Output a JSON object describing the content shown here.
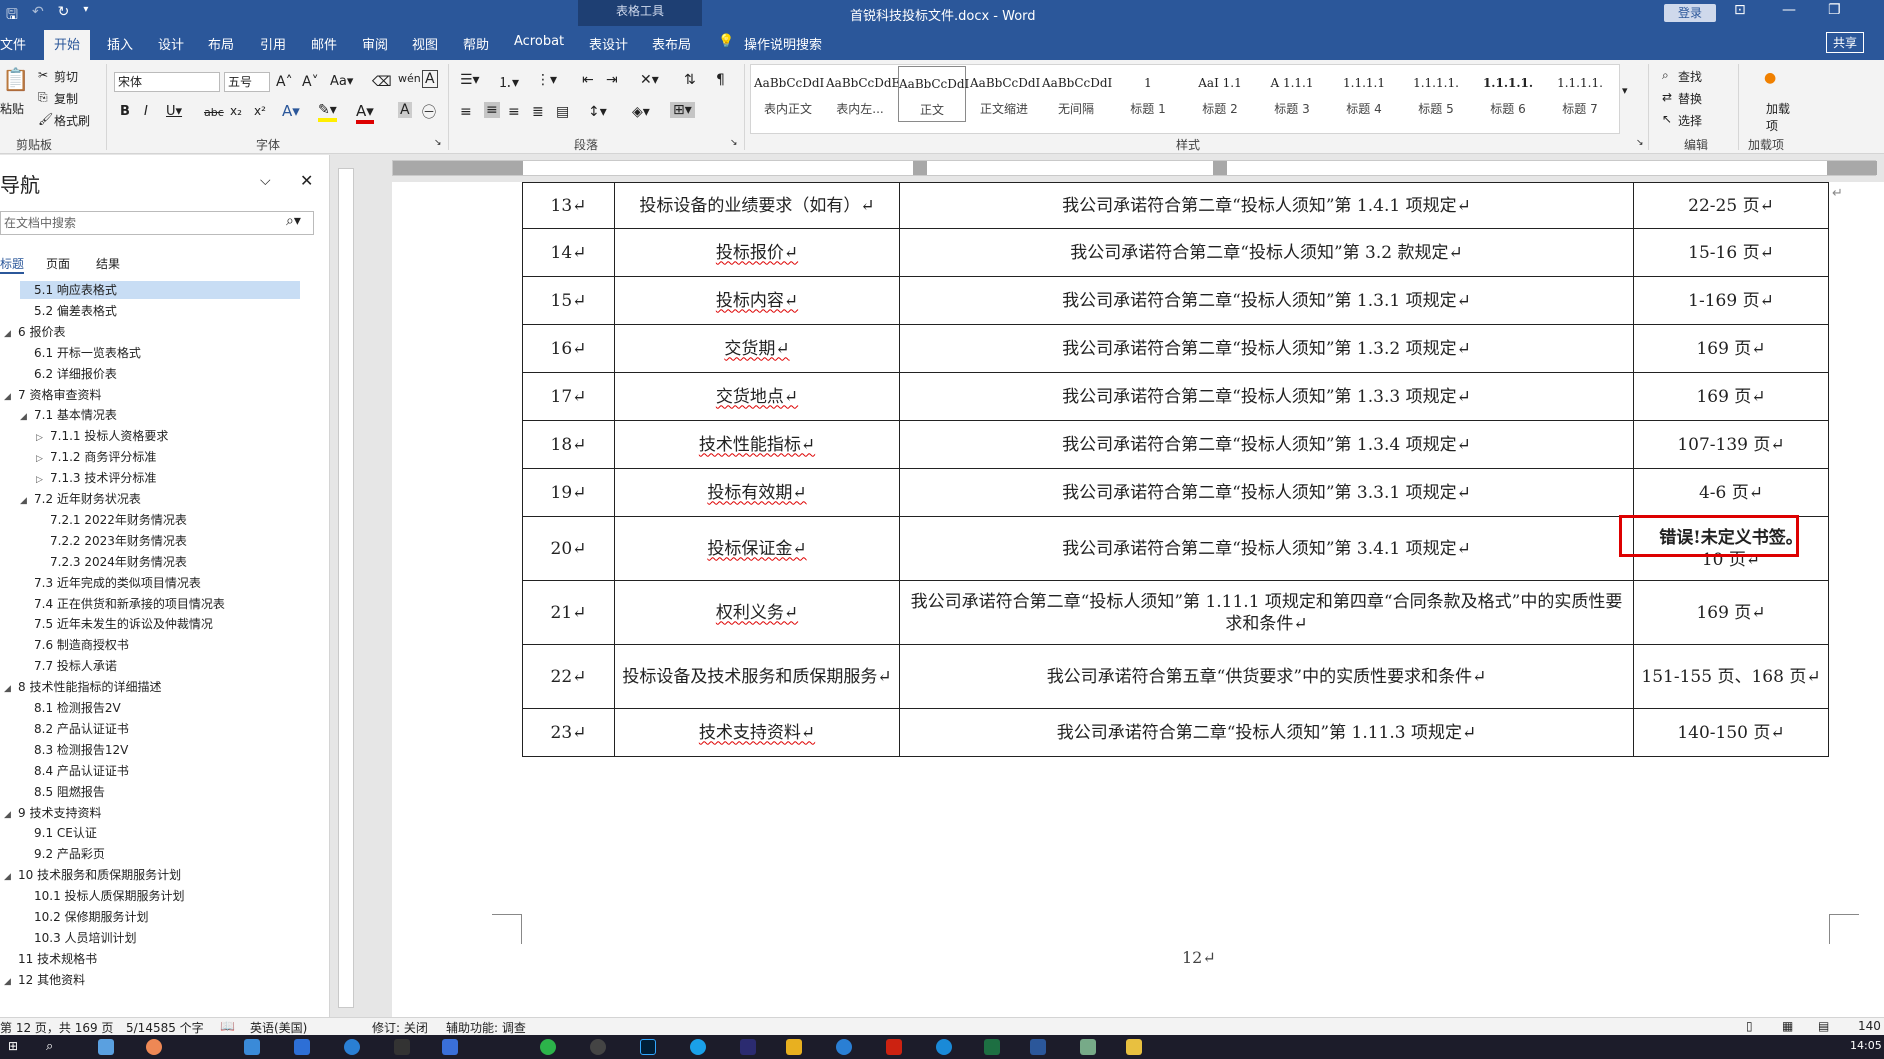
{
  "titlebar": {
    "context_tab": "表格工具",
    "document_title": "首锐科技投标文件.docx - Word",
    "login_label": "登录"
  },
  "tabs": [
    {
      "label": "文件"
    },
    {
      "label": "开始"
    },
    {
      "label": "插入"
    },
    {
      "label": "设计"
    },
    {
      "label": "布局"
    },
    {
      "label": "引用"
    },
    {
      "label": "邮件"
    },
    {
      "label": "审阅"
    },
    {
      "label": "视图"
    },
    {
      "label": "帮助"
    },
    {
      "label": "Acrobat"
    },
    {
      "label": "表设计"
    },
    {
      "label": "表布局"
    },
    {
      "label": "操作说明搜索"
    }
  ],
  "share_label": "共享",
  "ribbon": {
    "clipboard": {
      "paste": "粘贴",
      "cut": "剪切",
      "copy": "复制",
      "format_painter": "格式刷",
      "label": "剪贴板"
    },
    "font": {
      "family": "宋体",
      "size": "五号",
      "label": "字体"
    },
    "paragraph": {
      "label": "段落"
    },
    "styles": {
      "label": "样式",
      "items": [
        {
          "preview": "AaBbCcDdI",
          "name": "表内正文"
        },
        {
          "preview": "AaBbCcDdEe",
          "name": "表内左..."
        },
        {
          "preview": "AaBbCcDdI",
          "name": "正文"
        },
        {
          "preview": "AaBbCcDdI",
          "name": "正文缩进"
        },
        {
          "preview": "AaBbCcDdI",
          "name": "无间隔"
        },
        {
          "preview": "1",
          "name": "标题 1"
        },
        {
          "preview": "AaI 1.1",
          "name": "标题 2"
        },
        {
          "preview": "A 1.1.1",
          "name": "标题 3"
        },
        {
          "preview": "1.1.1.1",
          "name": "标题 4"
        },
        {
          "preview": "1.1.1.1.",
          "name": "标题 5"
        },
        {
          "preview": "1.1.1.1.",
          "name": "标题 6"
        },
        {
          "preview": "1.1.1.1.",
          "name": "标题 7"
        }
      ]
    },
    "editing": {
      "find": "查找",
      "replace": "替换",
      "select": "选择",
      "label": "编辑"
    },
    "addins": {
      "load": "加载项",
      "label": "加载项"
    }
  },
  "nav": {
    "title": "导航",
    "search_placeholder": "在文档中搜索",
    "tabs": [
      "标题",
      "页面",
      "结果"
    ],
    "items": [
      {
        "label": "5.1 响应表格式",
        "indent": 2,
        "toggle": "",
        "selected": true
      },
      {
        "label": "5.2 偏差表格式",
        "indent": 2,
        "toggle": ""
      },
      {
        "label": "6 报价表",
        "indent": 1,
        "toggle": "◢"
      },
      {
        "label": "6.1 开标一览表格式",
        "indent": 2,
        "toggle": ""
      },
      {
        "label": "6.2 详细报价表",
        "indent": 2,
        "toggle": ""
      },
      {
        "label": "7 资格审查资料",
        "indent": 1,
        "toggle": "◢"
      },
      {
        "label": "7.1 基本情况表",
        "indent": 2,
        "toggle": "◢"
      },
      {
        "label": "7.1.1 投标人资格要求",
        "indent": 3,
        "toggle": "▷"
      },
      {
        "label": "7.1.2 商务评分标准",
        "indent": 3,
        "toggle": "▷"
      },
      {
        "label": "7.1.3 技术评分标准",
        "indent": 3,
        "toggle": "▷"
      },
      {
        "label": "7.2 近年财务状况表",
        "indent": 2,
        "toggle": "◢"
      },
      {
        "label": "7.2.1 2022年财务情况表",
        "indent": 3,
        "toggle": ""
      },
      {
        "label": "7.2.2 2023年财务情况表",
        "indent": 3,
        "toggle": ""
      },
      {
        "label": "7.2.3 2024年财务情况表",
        "indent": 3,
        "toggle": ""
      },
      {
        "label": "7.3 近年完成的类似项目情况表",
        "indent": 2,
        "toggle": ""
      },
      {
        "label": "7.4 正在供货和新承接的项目情况表",
        "indent": 2,
        "toggle": ""
      },
      {
        "label": "7.5 近年未发生的诉讼及仲裁情况",
        "indent": 2,
        "toggle": ""
      },
      {
        "label": "7.6 制造商授权书",
        "indent": 2,
        "toggle": ""
      },
      {
        "label": "7.7 投标人承诺",
        "indent": 2,
        "toggle": ""
      },
      {
        "label": "8 技术性能指标的详细描述",
        "indent": 1,
        "toggle": "◢"
      },
      {
        "label": "8.1 检测报告2V",
        "indent": 2,
        "toggle": ""
      },
      {
        "label": "8.2 产品认证证书",
        "indent": 2,
        "toggle": ""
      },
      {
        "label": "8.3 检测报告12V",
        "indent": 2,
        "toggle": ""
      },
      {
        "label": "8.4 产品认证证书",
        "indent": 2,
        "toggle": ""
      },
      {
        "label": "8.5 阻燃报告",
        "indent": 2,
        "toggle": ""
      },
      {
        "label": "9 技术支持资料",
        "indent": 1,
        "toggle": "◢"
      },
      {
        "label": "9.1 CE认证",
        "indent": 2,
        "toggle": ""
      },
      {
        "label": "9.2 产品彩页",
        "indent": 2,
        "toggle": ""
      },
      {
        "label": "10 技术服务和质保期服务计划",
        "indent": 1,
        "toggle": "◢"
      },
      {
        "label": "10.1 投标人质保期服务计划",
        "indent": 2,
        "toggle": ""
      },
      {
        "label": "10.2 保修期服务计划",
        "indent": 2,
        "toggle": ""
      },
      {
        "label": "10.3 人员培训计划",
        "indent": 2,
        "toggle": ""
      },
      {
        "label": "11 技术规格书",
        "indent": 1,
        "toggle": ""
      },
      {
        "label": "12 其他资料",
        "indent": 1,
        "toggle": "◢"
      }
    ]
  },
  "table": {
    "rows": [
      {
        "no": "13↵",
        "item": "投标设备的业绩要求（如有）↵",
        "desc": "我公司承诺符合第二章“投标人须知”第 1.4.1 项规定↵",
        "page": "22-25 页↵",
        "underline": false
      },
      {
        "no": "14↵",
        "item": "投标报价↵",
        "desc": "我公司承诺符合第二章“投标人须知”第 3.2 款规定↵",
        "page": "15-16 页↵",
        "underline": true
      },
      {
        "no": "15↵",
        "item": "投标内容↵",
        "desc": "我公司承诺符合第二章“投标人须知”第 1.3.1 项规定↵",
        "page": "1-169 页↵",
        "underline": true
      },
      {
        "no": "16↵",
        "item": "交货期↵",
        "desc": "我公司承诺符合第二章“投标人须知”第 1.3.2 项规定↵",
        "page": "169 页↵",
        "underline": true
      },
      {
        "no": "17↵",
        "item": "交货地点↵",
        "desc": "我公司承诺符合第二章“投标人须知”第 1.3.3 项规定↵",
        "page": "169 页↵",
        "underline": true
      },
      {
        "no": "18↵",
        "item": "技术性能指标↵",
        "desc": "我公司承诺符合第二章“投标人须知”第 1.3.4 项规定↵",
        "page": "107-139 页↵",
        "underline": true
      },
      {
        "no": "19↵",
        "item": "投标有效期↵",
        "desc": "我公司承诺符合第二章“投标人须知”第 3.3.1 项规定↵",
        "page": "4-6 页↵",
        "underline": true
      },
      {
        "no": "20↵",
        "item": "投标保证金↵",
        "desc": "我公司承诺符合第二章“投标人须知”第 3.4.1 项规定↵",
        "page": "10 页↵",
        "underline": true,
        "error": "错误!未定义书签。"
      },
      {
        "no": "21↵",
        "item": "权利义务↵",
        "desc": "我公司承诺符合第二章“投标人须知”第 1.11.1 项规定和第四章“合同条款及格式”中的实质性要求和条件↵",
        "page": "169 页↵",
        "underline": true
      },
      {
        "no": "22↵",
        "item": "投标设备及技术服务和质保期服务↵",
        "desc": "我公司承诺符合第五章“供货要求”中的实质性要求和条件↵",
        "page": "151-155 页、168 页↵",
        "underline": false
      },
      {
        "no": "23↵",
        "item": "技术支持资料↵",
        "desc": "我公司承诺符合第二章“投标人须知”第 1.11.3 项规定↵",
        "page": "140-150 页↵",
        "underline": true
      }
    ]
  },
  "page_number": "12↵",
  "status": {
    "page": "第 12 页，共 169 页",
    "words": "5/14585 个字",
    "language": "英语(美国)",
    "track": "修订: 关闭",
    "accessibility": "辅助功能: 调查",
    "zoom": "140"
  },
  "clock": "14:05",
  "colors": {
    "accent": "#2b579a",
    "error_box": "#dd0000",
    "nav_selected": "#c8ddf4"
  }
}
